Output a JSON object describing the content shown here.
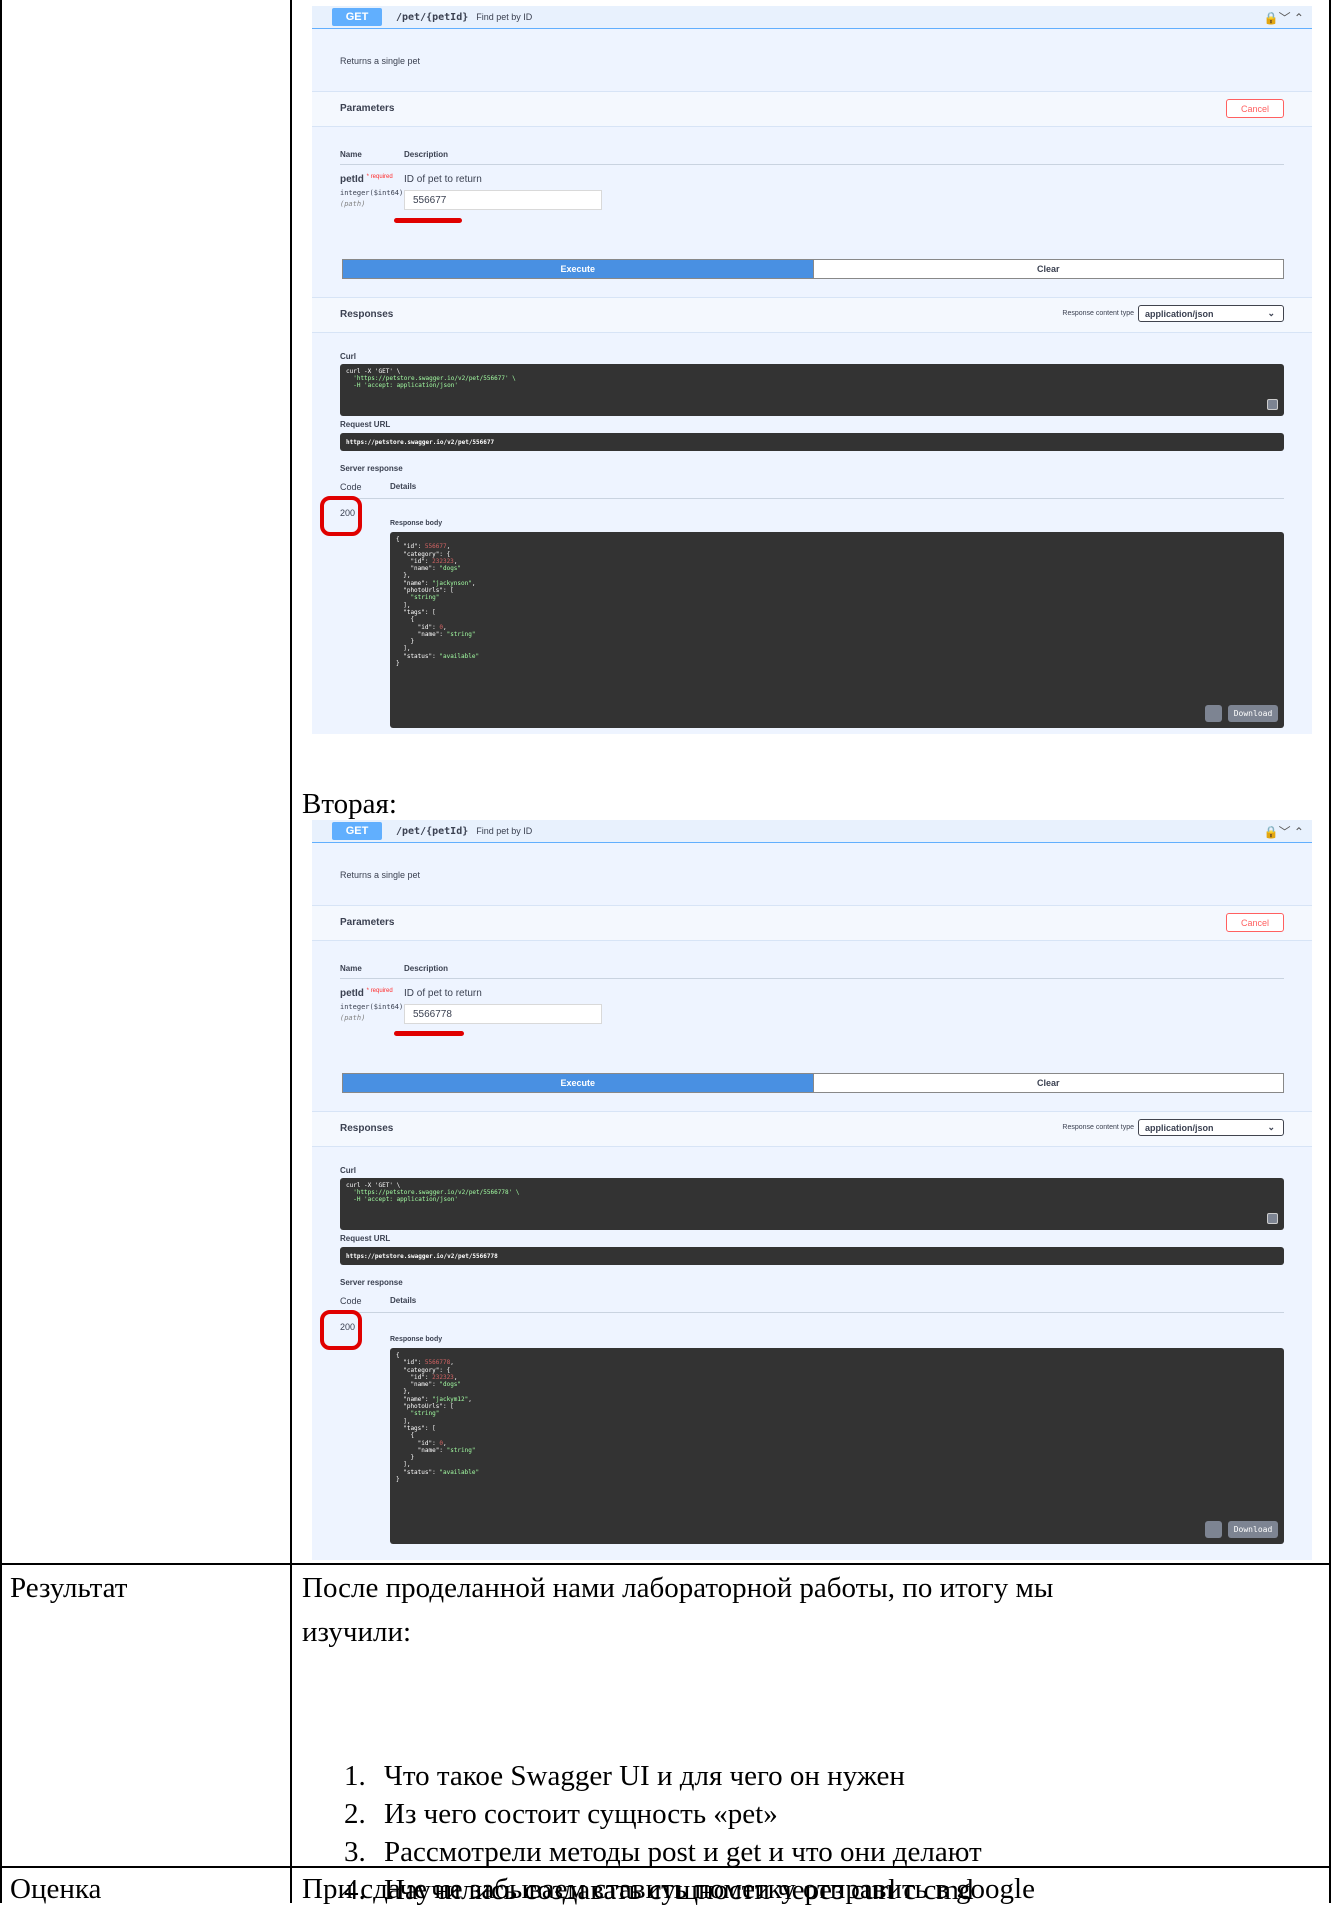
{
  "swagger": {
    "method": "GET",
    "path": "/pet/{petId}",
    "summary": "Find pet by ID",
    "description": "Returns a single pet",
    "parameters_title": "Parameters",
    "cancel_label": "Cancel",
    "col_name": "Name",
    "col_description": "Description",
    "param_name": "petId",
    "param_required_mark": "*",
    "param_required": "required",
    "param_type": "integer($int64)",
    "param_in": "(path)",
    "param_description": "ID of pet to return",
    "execute_label": "Execute",
    "clear_label": "Clear",
    "responses_title": "Responses",
    "response_content_type_label": "Response content type",
    "response_content_type_value": "application/json",
    "curl_label": "Curl",
    "request_url_label": "Request URL",
    "server_response_label": "Server response",
    "code_header": "Code",
    "details_header": "Details",
    "response_body_label": "Response body",
    "download_label": "Download"
  },
  "shots": [
    {
      "param_value": "556677",
      "curl_line1": "curl -X 'GET' \\",
      "curl_line2": "  'https://petstore.swagger.io/v2/pet/556677' \\",
      "curl_line3": "  -H 'accept: application/json'",
      "request_url": "https://petstore.swagger.io/v2/pet/556677",
      "status_code": "200",
      "body": {
        "id": "556677",
        "category_id": "232323",
        "category_name": "\"dogs\"",
        "name": "\"jackynson\"",
        "photo": "\"string\"",
        "tag_id": "0",
        "tag_name": "\"string\"",
        "status": "\"available\""
      }
    },
    {
      "param_value": "5566778",
      "curl_line1": "curl -X 'GET' \\",
      "curl_line2": "  'https://petstore.swagger.io/v2/pet/5566778' \\",
      "curl_line3": "  -H 'accept: application/json'",
      "request_url": "https://petstore.swagger.io/v2/pet/5566778",
      "status_code": "200",
      "body": {
        "id": "5566778",
        "category_id": "232323",
        "category_name": "\"dogs\"",
        "name": "\"jackym12\"",
        "photo": "\"string\"",
        "tag_id": "0",
        "tag_name": "\"string\"",
        "status": "\"available\""
      }
    }
  ],
  "second_label": "Вторая:",
  "result": {
    "label": "Результат",
    "intro_line1": "После проделанной нами лабораторной работы, по итогу мы",
    "intro_line2": "изучили:",
    "items": [
      {
        "n": "1.",
        "text": "Что такое Swagger UI и для чего он нужен"
      },
      {
        "n": "2.",
        "text": "Из чего состоит сущность «pet»"
      },
      {
        "n": "3.",
        "text": "Рассмотрели методы post и get и что они делают"
      },
      {
        "n": "4.",
        "text": "Научились создавать сущности через curl с cmd"
      }
    ]
  },
  "grade": {
    "label": "Оценка",
    "text": "При сдаче не забываем ставить пометку отправить в google"
  }
}
